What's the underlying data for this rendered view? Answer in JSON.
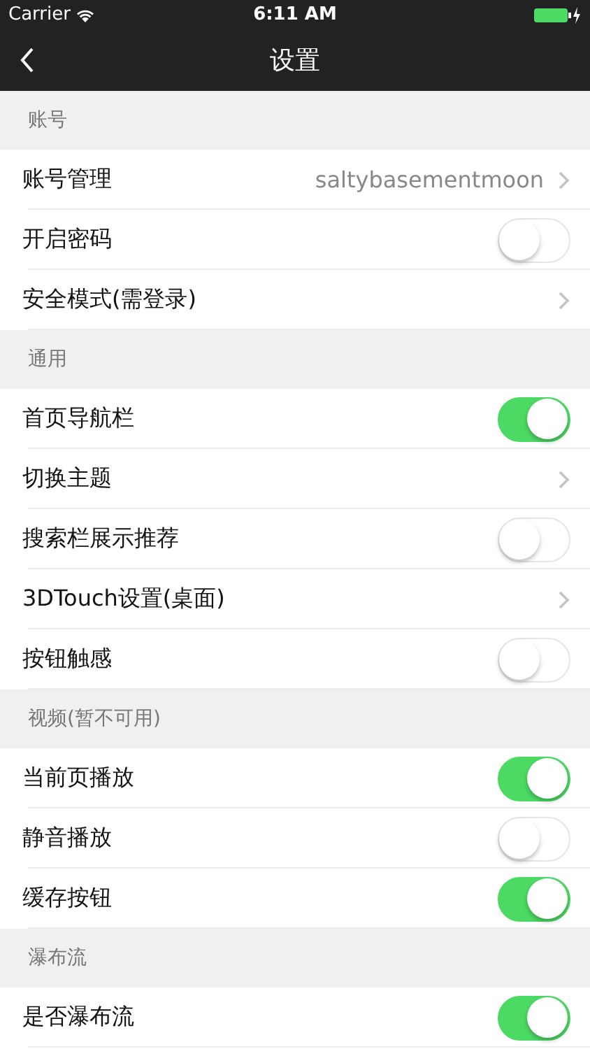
{
  "status_bar": {
    "carrier": "Carrier",
    "time": "6:11 AM"
  },
  "nav_bar": {
    "title": "设置"
  },
  "sections": [
    {
      "title": "账号",
      "rows": [
        {
          "kind": "link",
          "label": "账号管理",
          "value": "saltybasementmoon"
        },
        {
          "kind": "switch",
          "label": "开启密码",
          "on": false
        },
        {
          "kind": "link",
          "label": "安全模式(需登录)"
        }
      ]
    },
    {
      "title": "通用",
      "rows": [
        {
          "kind": "switch",
          "label": "首页导航栏",
          "on": true
        },
        {
          "kind": "link",
          "label": "切换主题"
        },
        {
          "kind": "switch",
          "label": "搜索栏展示推荐",
          "on": false
        },
        {
          "kind": "link",
          "label": "3DTouch设置(桌面)"
        },
        {
          "kind": "switch",
          "label": "按钮触感",
          "on": false
        }
      ]
    },
    {
      "title": "视频(暂不可用)",
      "rows": [
        {
          "kind": "switch",
          "label": "当前页播放",
          "on": true
        },
        {
          "kind": "switch",
          "label": "静音播放",
          "on": false
        },
        {
          "kind": "switch",
          "label": "缓存按钮",
          "on": true
        }
      ]
    },
    {
      "title": "瀑布流",
      "rows": [
        {
          "kind": "switch",
          "label": "是否瀑布流",
          "on": true
        }
      ]
    }
  ]
}
